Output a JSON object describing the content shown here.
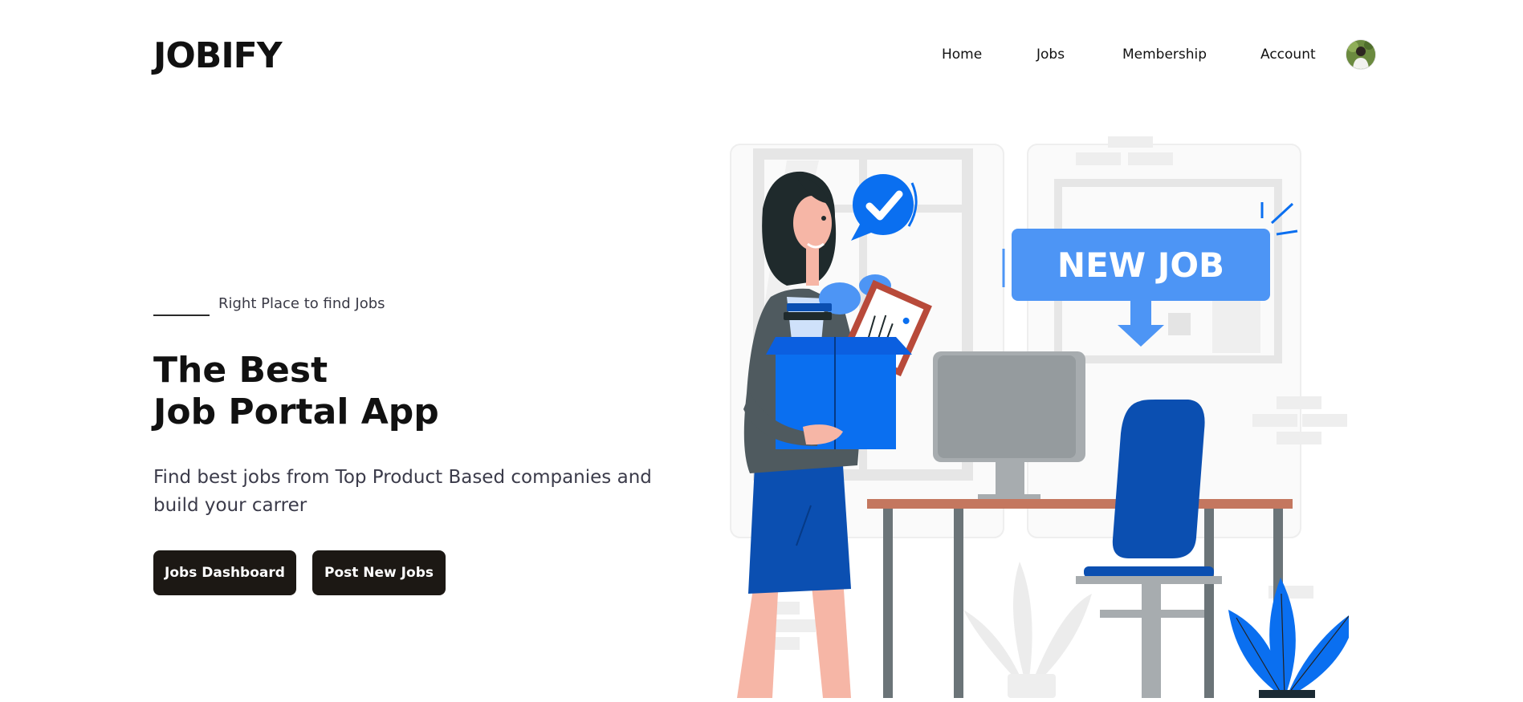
{
  "header": {
    "logo": "JOBIFY",
    "nav": [
      "Home",
      "Jobs",
      "Membership",
      "Account"
    ],
    "avatar_icon": "user-avatar"
  },
  "hero": {
    "tagline": "Right Place to find Jobs",
    "title_line1": "The Best",
    "title_line2": "Job Portal App",
    "description": "Find best jobs from Top Product Based companies and build your carrer",
    "buttons": {
      "primary": "Jobs Dashboard",
      "secondary": "Post New Jobs"
    }
  },
  "illustration": {
    "sign_text": "NEW JOB",
    "accent": "#0a6ff0",
    "accent_light": "#4d95f5",
    "accent_dark": "#0b4fb1"
  }
}
